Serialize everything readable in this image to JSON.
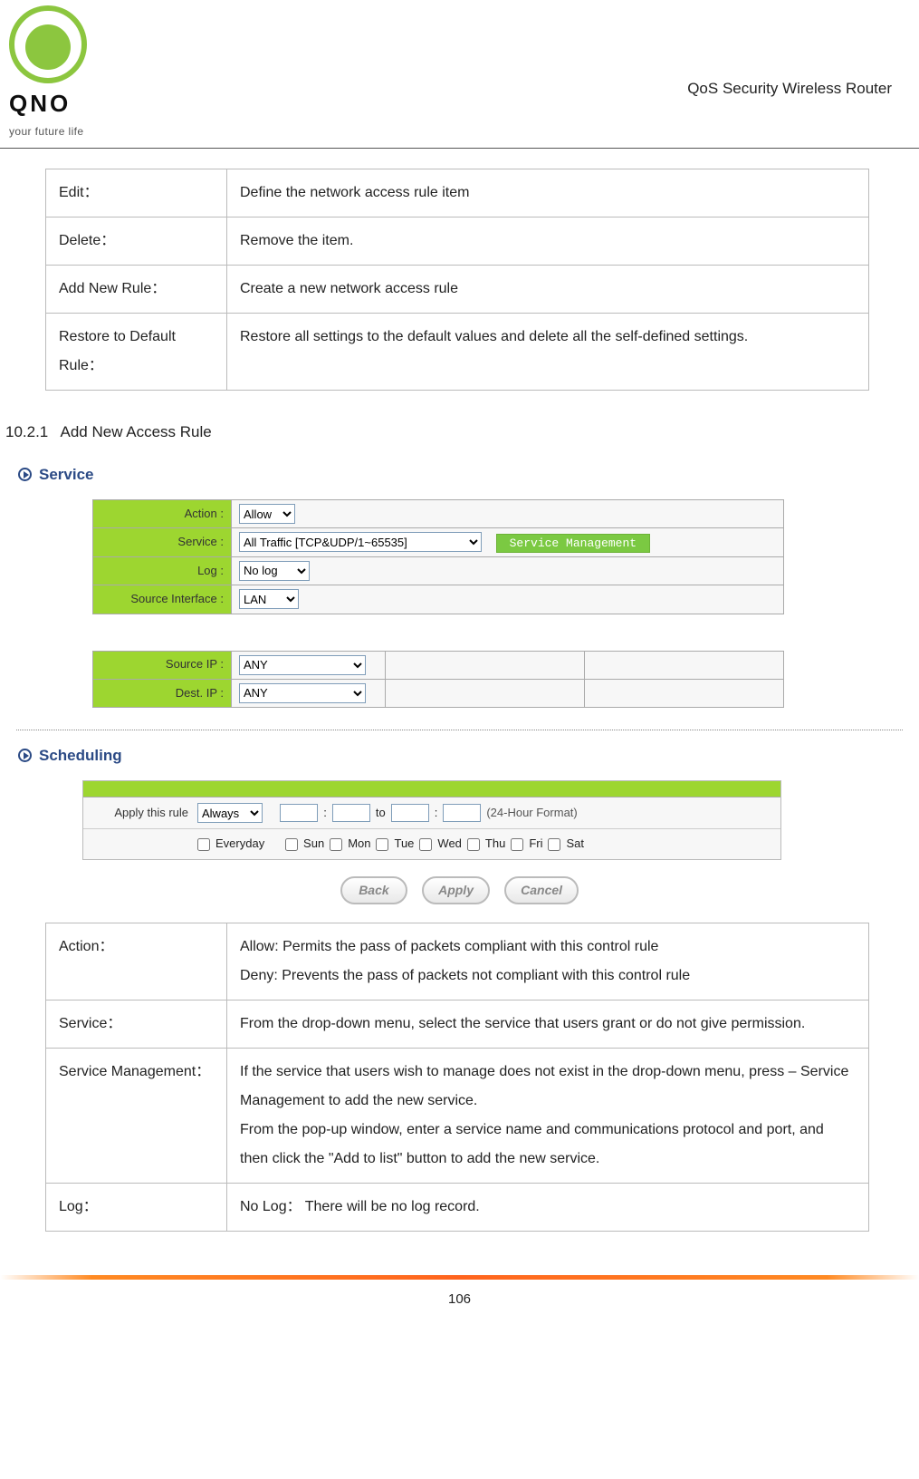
{
  "header": {
    "brand": "QNO",
    "tagline": "your future life",
    "right_text": "QoS Security Wireless Router"
  },
  "top_table": [
    {
      "term": "Edit：",
      "desc": "Define the network access rule item"
    },
    {
      "term": "Delete：",
      "desc": "Remove the item."
    },
    {
      "term": "Add New Rule：",
      "desc": "Create a new network access rule"
    },
    {
      "term": "Restore to Default Rule：",
      "desc": "Restore all settings to the default values and delete all the self-defined settings."
    }
  ],
  "section_number": "10.2.1",
  "section_title": "Add New Access Rule",
  "service_panel": {
    "title": "Service",
    "rows": {
      "action": {
        "label": "Action :",
        "value": "Allow"
      },
      "service": {
        "label": "Service :",
        "value": "All Traffic [TCP&UDP/1~65535]",
        "button": "Service Management"
      },
      "log": {
        "label": "Log :",
        "value": "No log"
      },
      "src_if": {
        "label": "Source Interface :",
        "value": "LAN"
      },
      "src_ip": {
        "label": "Source IP :",
        "value": "ANY"
      },
      "dst_ip": {
        "label": "Dest. IP :",
        "value": "ANY"
      }
    }
  },
  "scheduling_panel": {
    "title": "Scheduling",
    "apply_label": "Apply this rule",
    "apply_value": "Always",
    "to_label": "to",
    "format_note": "(24-Hour Format)",
    "everyday": "Everyday",
    "days": [
      "Sun",
      "Mon",
      "Tue",
      "Wed",
      "Thu",
      "Fri",
      "Sat"
    ]
  },
  "buttons": {
    "back": "Back",
    "apply": "Apply",
    "cancel": "Cancel"
  },
  "bottom_table": [
    {
      "term": "Action：",
      "desc": "Allow: Permits the pass of packets compliant with this control rule\nDeny: Prevents the pass of packets not compliant with this control rule"
    },
    {
      "term": "Service：",
      "desc": "From the drop-down menu, select the service that users grant or do not give permission."
    },
    {
      "term": "Service Management：",
      "desc": "If the service that users wish to manage does not exist in the drop-down menu, press – Service Management to add the new service.\nFrom the pop-up window, enter a service name and communications protocol and port, and then click the \"Add to list\" button to add the new service."
    },
    {
      "term": "Log：",
      "desc": "No Log：  There will be no log record."
    }
  ],
  "page_number": "106"
}
